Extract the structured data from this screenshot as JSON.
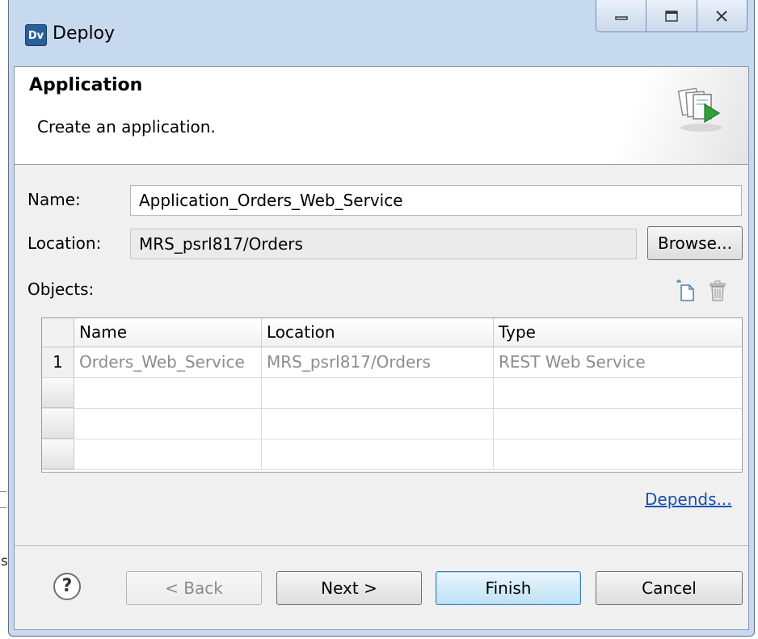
{
  "window": {
    "app_icon_text": "Dv",
    "title": "Deploy",
    "controls": {
      "minimize": "minimize-icon",
      "maximize": "maximize-icon",
      "close": "close-icon"
    }
  },
  "banner": {
    "title": "Application",
    "description": "Create an application.",
    "icon": "deploy-application-icon"
  },
  "form": {
    "name_label": "Name:",
    "name_value": "Application_Orders_Web_Service",
    "location_label": "Location:",
    "location_value": "MRS_psrl817/Orders",
    "browse_label": "Browse...",
    "objects_label": "Objects:",
    "objects_toolbar": [
      "new-object-icon",
      "delete-icon"
    ]
  },
  "table": {
    "columns": [
      "Name",
      "Location",
      "Type"
    ],
    "rows": [
      {
        "index": "1",
        "name": "Orders_Web_Service",
        "location": "MRS_psrl817/Orders",
        "type": "REST Web Service"
      }
    ]
  },
  "depends_link": "Depends...",
  "footer": {
    "help_glyph": "?",
    "back_label": "< Back",
    "next_label": "Next >",
    "finish_label": "Finish",
    "cancel_label": "Cancel"
  },
  "background": {
    "stray_text": "s"
  },
  "colors": {
    "title_bar": "#c7d9ee",
    "link": "#1a4fb0",
    "default_button_border": "#3c7fb1",
    "disabled_text": "#8a8a8a"
  }
}
